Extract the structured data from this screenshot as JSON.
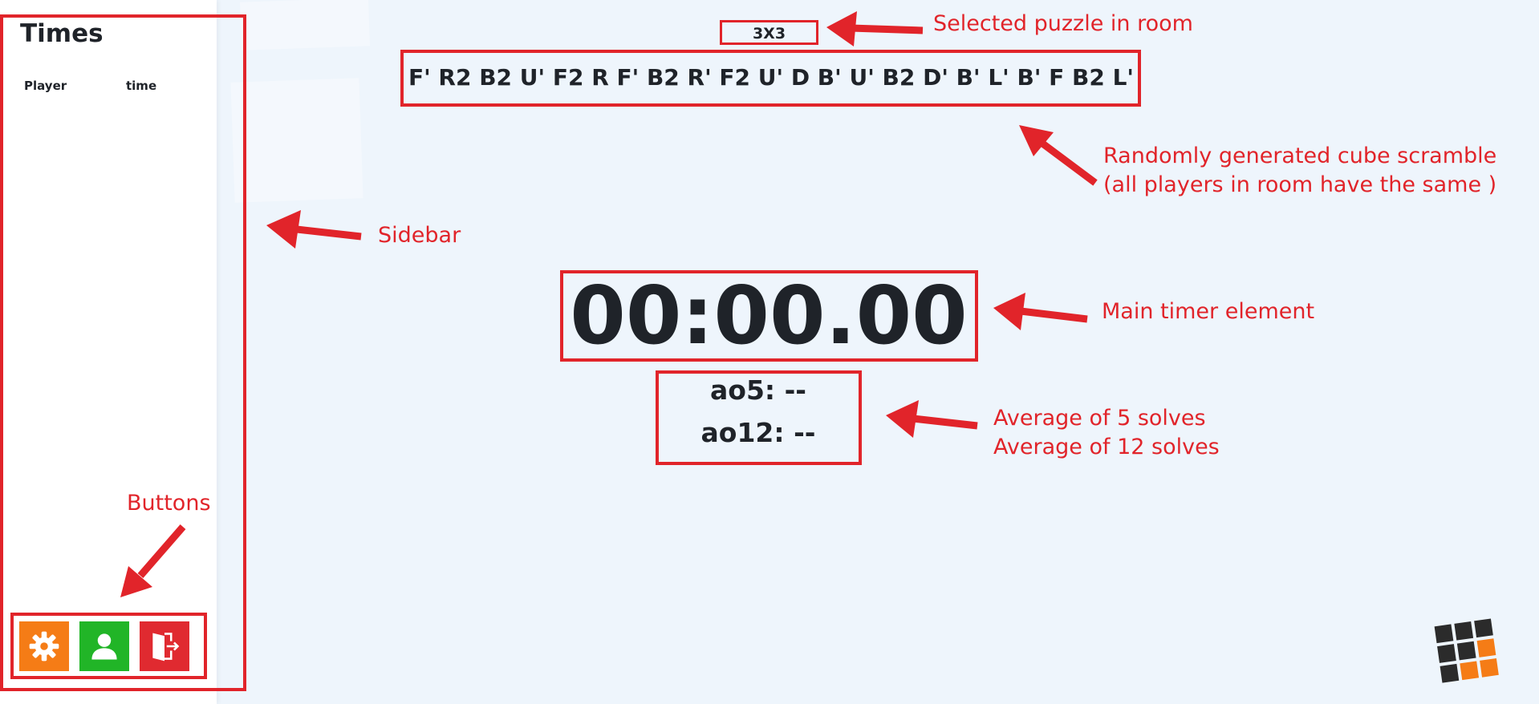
{
  "sidebar": {
    "title": "Times",
    "columns": [
      "Player",
      "time"
    ],
    "buttons": [
      {
        "name": "settings",
        "icon": "gear-icon",
        "color": "#f57c16"
      },
      {
        "name": "profile",
        "icon": "user-icon",
        "color": "#21b527"
      },
      {
        "name": "leave-room",
        "icon": "exit-door-icon",
        "color": "#e02a30"
      }
    ]
  },
  "main": {
    "puzzle": "3X3",
    "scramble": "F' R2 B2 U' F2 R F' B2 R' F2 U' D B' U' B2 D' B' L' B' F B2 L'",
    "timer": "00:00.00",
    "ao5": "ao5: --",
    "ao12": "ao12: --"
  },
  "annotations": {
    "puzzle": "Selected puzzle in room",
    "scramble_line1": "Randomly generated cube scramble",
    "scramble_line2": "(all players in room have the same )",
    "sidebar": "Sidebar",
    "timer": "Main timer element",
    "averages_line1": "Average of 5 solves",
    "averages_line2": "Average of 12 solves",
    "buttons": "Buttons"
  },
  "colors": {
    "annotation": "#e1242a",
    "background": "#eef5fc",
    "logo_dark": "#2b2b2b",
    "logo_accent": "#f57c16"
  },
  "logo": {
    "icon": "cube-logo-icon"
  }
}
